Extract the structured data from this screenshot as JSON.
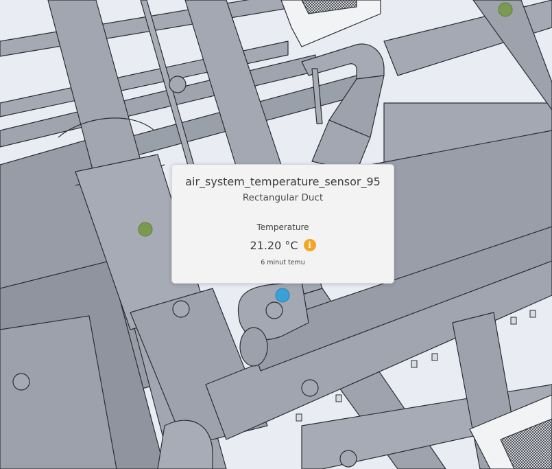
{
  "tooltip": {
    "title": "air_system_temperature_sensor_95",
    "subtitle": "Rectangular Duct",
    "property_label": "Temperature",
    "property_value": "21.20 °C",
    "status_icon": "info-icon",
    "status_color": "#f5a524",
    "timestamp": "6 minut temu"
  },
  "sensors": [
    {
      "name": "sensor-marker-green",
      "color": "#7a9a4f"
    },
    {
      "name": "sensor-marker-green",
      "color": "#7a9a4f"
    },
    {
      "name": "sensor-marker-blue",
      "color": "#3aa0d8"
    }
  ],
  "scene": {
    "pipe_color": "#9aa0ac",
    "pipe_edge_color": "#2a2d33",
    "background_color": "#e9ecf2"
  }
}
